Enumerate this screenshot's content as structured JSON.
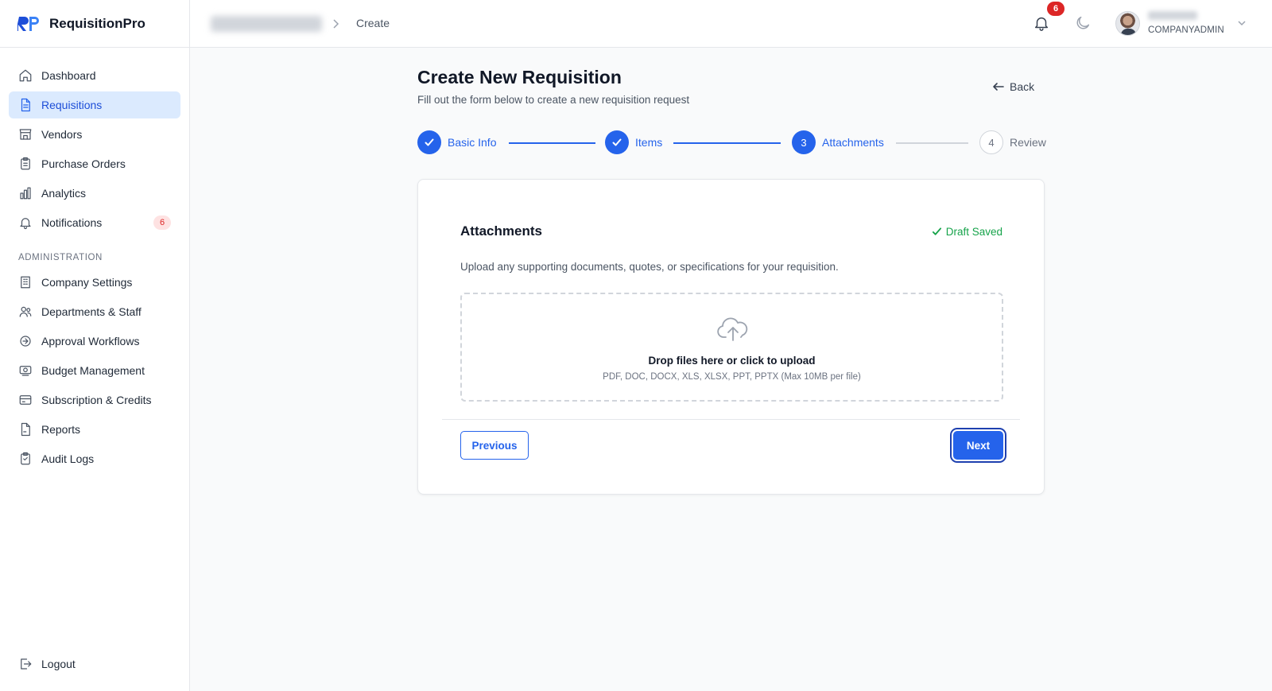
{
  "app": {
    "name": "RequisitionPro",
    "accent_color": "#2563eb"
  },
  "sidebar": {
    "items": [
      {
        "label": "Dashboard",
        "icon": "home-icon",
        "active": false
      },
      {
        "label": "Requisitions",
        "icon": "document-icon",
        "active": true
      },
      {
        "label": "Vendors",
        "icon": "store-icon",
        "active": false
      },
      {
        "label": "Purchase Orders",
        "icon": "clipboard-icon",
        "active": false
      },
      {
        "label": "Analytics",
        "icon": "bar-chart-icon",
        "active": false
      },
      {
        "label": "Notifications",
        "icon": "bell-icon",
        "active": false,
        "badge": "6"
      }
    ],
    "admin_section_label": "ADMINISTRATION",
    "admin_items": [
      {
        "label": "Company Settings",
        "icon": "building-icon"
      },
      {
        "label": "Departments & Staff",
        "icon": "users-icon"
      },
      {
        "label": "Approval Workflows",
        "icon": "workflow-icon"
      },
      {
        "label": "Budget Management",
        "icon": "budget-icon"
      },
      {
        "label": "Subscription & Credits",
        "icon": "credit-card-icon"
      },
      {
        "label": "Reports",
        "icon": "report-icon"
      },
      {
        "label": "Audit Logs",
        "icon": "audit-icon"
      }
    ],
    "logout_label": "Logout"
  },
  "topbar": {
    "breadcrumb_current": "Create",
    "notification_count": "6",
    "user_role": "COMPANYADMIN"
  },
  "page": {
    "title": "Create New Requisition",
    "subtitle": "Fill out the form below to create a new requisition request",
    "back_label": "Back"
  },
  "stepper": {
    "steps": [
      {
        "number": "1",
        "label": "Basic Info",
        "state": "done"
      },
      {
        "number": "2",
        "label": "Items",
        "state": "done"
      },
      {
        "number": "3",
        "label": "Attachments",
        "state": "current"
      },
      {
        "number": "4",
        "label": "Review",
        "state": "pending"
      }
    ]
  },
  "card": {
    "title": "Attachments",
    "draft_status": "Draft Saved",
    "description": "Upload any supporting documents, quotes, or specifications for your requisition.",
    "dropzone_title": "Drop files here or click to upload",
    "dropzone_hint": "PDF, DOC, DOCX, XLS, XLSX, PPT, PPTX (Max 10MB per file)",
    "previous_label": "Previous",
    "next_label": "Next"
  }
}
